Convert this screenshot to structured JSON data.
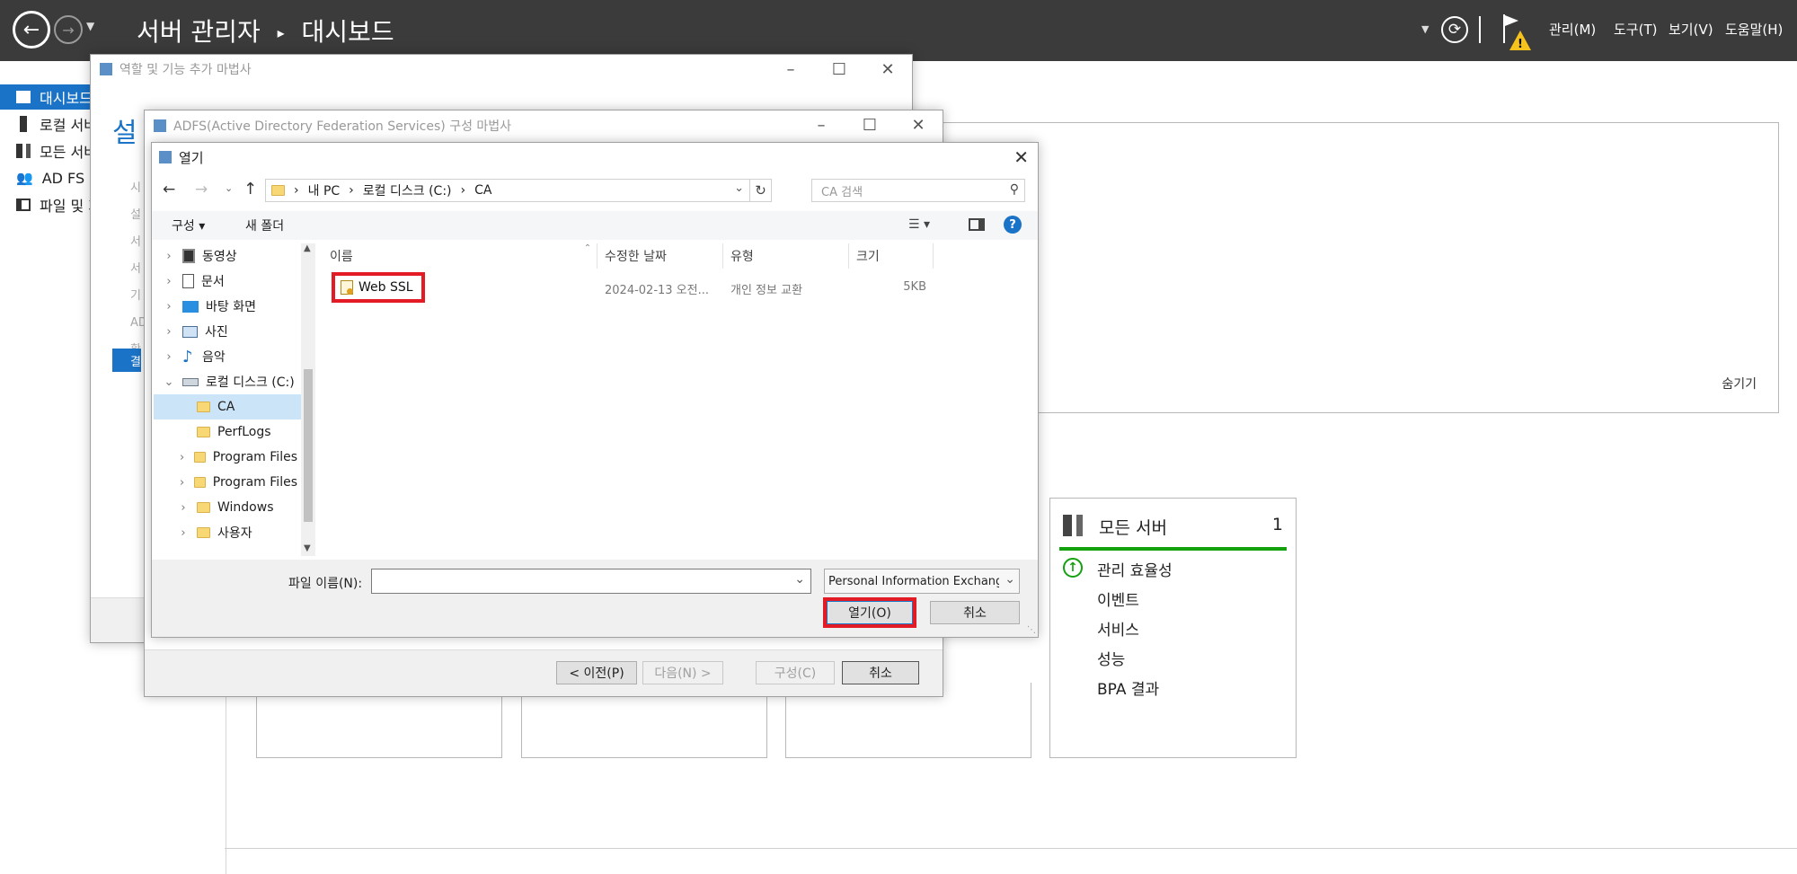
{
  "header": {
    "title": "서버 관리자",
    "breadcrumb_sep": "▸",
    "page": "대시보드",
    "menus": [
      "관리(M)",
      "도구(T)",
      "보기(V)",
      "도움말(H)"
    ]
  },
  "left_nav": {
    "items": [
      {
        "label": "대시보드",
        "icon": "dashboard-icon"
      },
      {
        "label": "로컬 서버",
        "icon": "local-server-icon"
      },
      {
        "label": "모든 서버",
        "icon": "servers-icon"
      },
      {
        "label": "AD FS",
        "icon": "adfs-icon"
      },
      {
        "label": "파일 및 저장소 서비스",
        "icon": "file-services-icon"
      }
    ]
  },
  "hide_link": "숨기기",
  "all_servers_tile": {
    "title": "모든 서버",
    "count": "1",
    "items": [
      "관리 효율성",
      "이벤트",
      "서비스",
      "성능",
      "BPA 결과"
    ],
    "status_color": "#13a10e"
  },
  "roles_wizard": {
    "title": "역할 및 기능 추가 마법사",
    "heading_fragment": "설",
    "steps_fragment": [
      "시",
      "설",
      "서",
      "서",
      "기",
      "AD",
      "확",
      "결"
    ]
  },
  "adfs_wizard": {
    "title": "ADFS(Active Directory Federation Services) 구성 마법사",
    "buttons": {
      "prev": "< 이전(P)",
      "next": "다음(N) >",
      "configure": "구성(C)",
      "cancel": "취소"
    }
  },
  "open_dialog": {
    "title": "열기",
    "address": {
      "pc": "내 PC",
      "drive": "로컬 디스크 (C:)",
      "folder": "CA",
      "sep": "›"
    },
    "search_placeholder": "CA 검색",
    "toolbar": {
      "organize": "구성 ▾",
      "new_folder": "새 폴더"
    },
    "tree": [
      {
        "label": "동영상",
        "icon": "video-icon",
        "expander": "›"
      },
      {
        "label": "문서",
        "icon": "document-icon",
        "expander": "›"
      },
      {
        "label": "바탕 화면",
        "icon": "desktop-icon",
        "expander": "›"
      },
      {
        "label": "사진",
        "icon": "picture-icon",
        "expander": "›"
      },
      {
        "label": "음악",
        "icon": "music-icon",
        "expander": "›"
      },
      {
        "label": "로컬 디스크 (C:)",
        "icon": "drive-icon",
        "expander": "⌄"
      },
      {
        "label": "CA",
        "icon": "folder-icon",
        "expander": ""
      },
      {
        "label": "PerfLogs",
        "icon": "folder-icon",
        "expander": ""
      },
      {
        "label": "Program Files",
        "icon": "folder-icon",
        "expander": "›"
      },
      {
        "label": "Program Files",
        "icon": "folder-icon",
        "expander": "›"
      },
      {
        "label": "Windows",
        "icon": "folder-icon",
        "expander": "›"
      },
      {
        "label": "사용자",
        "icon": "folder-icon",
        "expander": "›"
      }
    ],
    "columns": [
      "이름",
      "수정한 날짜",
      "유형",
      "크기"
    ],
    "files": [
      {
        "name": "Web SSL",
        "date": "2024-02-13 오전...",
        "type": "개인 정보 교환",
        "size": "5KB",
        "icon": "certificate-icon"
      }
    ],
    "filename_label": "파일 이름(N):",
    "filename_value": "",
    "filter": "Personal Information Exchange",
    "open_button": "열기(O)",
    "cancel_button": "취소"
  },
  "colors": {
    "header_bg": "#3b3b3b",
    "accent": "#1a73c7",
    "highlight": "#e21b24"
  }
}
